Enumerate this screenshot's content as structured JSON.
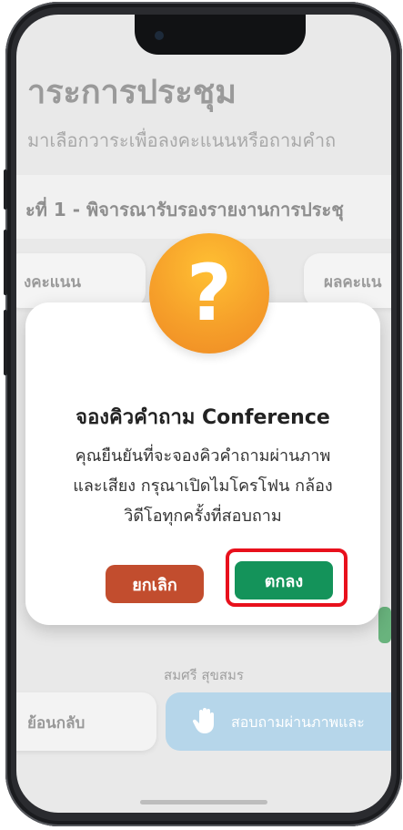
{
  "app": {
    "title": "าระการประชุม",
    "subtitle": "มาเลือกวาระเพื่อลงคะแนนหรือถามคำถ",
    "agenda_item": "ะที่ 1 - พิจารณารับรองรายงานการประชุ",
    "vote_button": "งคะแนน",
    "result_button": "ผลคะแน",
    "username": "สมศรี สุขสมร",
    "back_button": "ย้อนกลับ",
    "ask_video_button": "สอบถามผ่านภาพและ",
    "hand_icon": "raised-hand-icon"
  },
  "dialog": {
    "icon": "question-mark-icon",
    "icon_glyph": "?",
    "title": "จองคิวคำถาม Conference",
    "body_line1": "คุณยืนยันที่จะจองคิวคำถามผ่านภาพ",
    "body_line2": "และเสียง กรุณาเปิดไมโครโฟน กล้อง",
    "body_line3": "วิดีโอทุกครั้งที่สอบถาม",
    "cancel_label": "ยกเลิก",
    "confirm_label": "ตกลง"
  },
  "colors": {
    "confirm": "#14935a",
    "cancel": "#c24d2e",
    "highlight": "#e8101c",
    "question_icon": "#f6a02a"
  }
}
